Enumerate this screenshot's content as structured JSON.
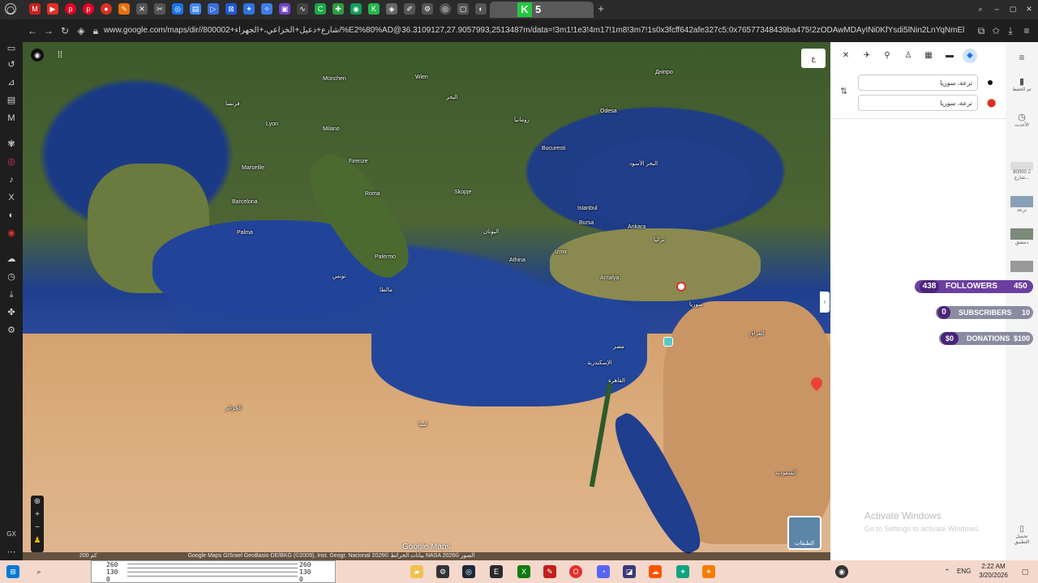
{
  "browser": {
    "active_tab_label": "5",
    "url": "www.google.com/maps/dir//800002+شارع+دعيل+الخزاعي،+الجهراء/%E2%80%AD@36.3109127,27.9057993,2513487m/data=!3m1!1e3!4m17!1m8!3m7!1s0x3fcff642afe327c5:0x76577348439ba475!2zODAwMDAyINi0KfYsdi5lNin2LnYqNmElNin2YTyiy2KfYudm"
  },
  "map": {
    "top_right_button": "ع",
    "attribution": "Google Maps GISrael GeoBasis-DE/BKG (©2009), Inst. Geogr. Nacional بيانات الخرائط ©2026 NASA الصور ©2026",
    "scale": "200 كم",
    "logo": "Google Maps",
    "layers_label": "الطبقات",
    "cities": [
      {
        "name": "München"
      },
      {
        "name": "Wien"
      },
      {
        "name": "Lyon"
      },
      {
        "name": "Milano"
      },
      {
        "name": "Marseille"
      },
      {
        "name": "Barcelona"
      },
      {
        "name": "Palma"
      },
      {
        "name": "Firenze"
      },
      {
        "name": "Roma"
      },
      {
        "name": "Palermo"
      },
      {
        "name": "Bucuresti"
      },
      {
        "name": "Odesa"
      },
      {
        "name": "Istanbul"
      },
      {
        "name": "Ankara"
      },
      {
        "name": "Bursa"
      },
      {
        "name": "Izmir"
      },
      {
        "name": "Athina"
      },
      {
        "name": "Antalya"
      },
      {
        "name": "Skopje"
      },
      {
        "name": "Днiпро"
      },
      {
        "name": "فرنسا"
      },
      {
        "name": "البحر"
      },
      {
        "name": "رومانيا"
      },
      {
        "name": "تركيا"
      },
      {
        "name": "ليبيا"
      },
      {
        "name": "الجزائر"
      },
      {
        "name": "تونس"
      },
      {
        "name": "مصر"
      },
      {
        "name": "سوريا"
      },
      {
        "name": "العراق"
      },
      {
        "name": "السعودية"
      },
      {
        "name": "الإسكندرية"
      },
      {
        "name": "القاهرة"
      },
      {
        "name": "البحر الأسود"
      },
      {
        "name": "اليونان"
      },
      {
        "name": "مالطا"
      }
    ]
  },
  "directions": {
    "origin_value": "ترعة، سوريا",
    "destination_value": "ترعة، سوريا"
  },
  "right_sidebar": {
    "items": [
      {
        "label": "تم الحفظ"
      },
      {
        "label": "الأحدث"
      },
      {
        "label": "80000 2 شارع..."
      },
      {
        "label": "ترعة"
      },
      {
        "label": "دمشق"
      },
      {
        "label": "تحميل التطبيق"
      }
    ]
  },
  "stream_overlay": {
    "followers_count": "438",
    "followers_label": "FOLLOWERS",
    "followers_goal": "450",
    "subscribers_count": "0",
    "subscribers_label": "SUBSCRIBERS",
    "subscribers_goal": "10",
    "donations_count": "$0",
    "donations_label": "DONATIONS",
    "donations_goal": "$100"
  },
  "windows": {
    "activate_title": "Activate Windows",
    "activate_sub": "Go to Settings to activate Windows."
  },
  "taskbar": {
    "graph_lines": [
      "260",
      "130",
      "0"
    ],
    "graph_lines_right": [
      "260",
      "130",
      "0"
    ],
    "clock_time": "2:22 AM",
    "clock_date": "3/20/2026",
    "lang": "ENG"
  }
}
